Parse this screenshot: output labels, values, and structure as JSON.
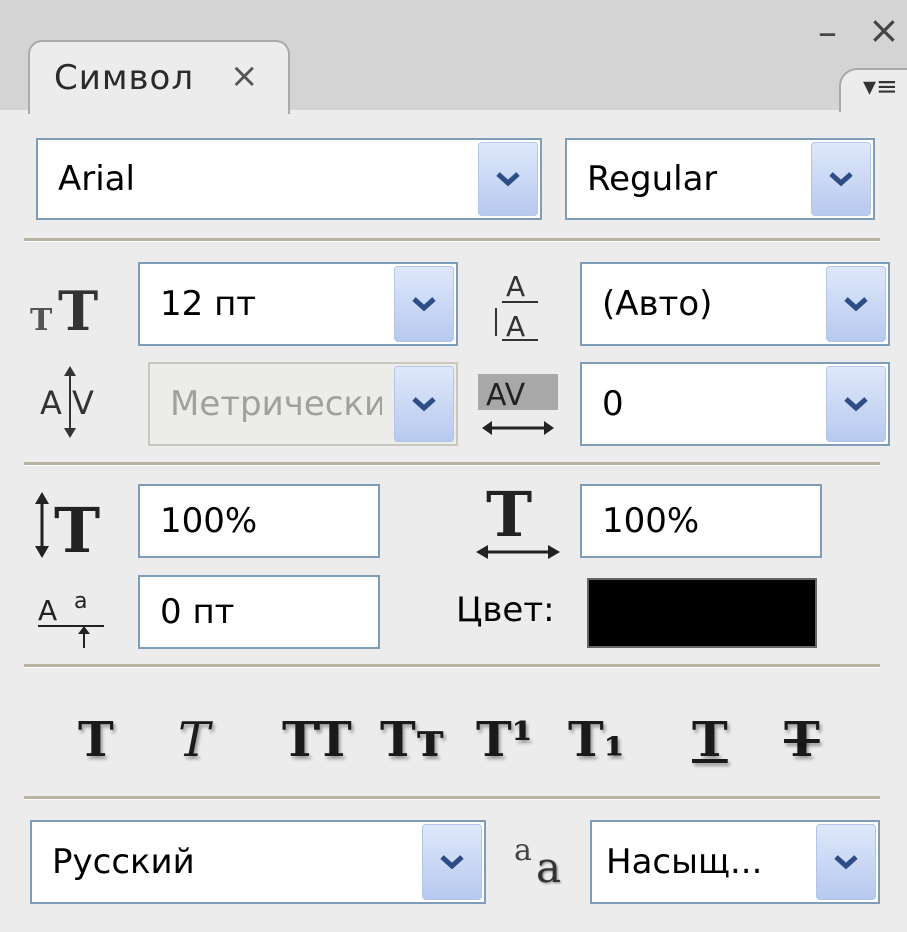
{
  "panel": {
    "tab_label": "Символ",
    "tab_close": "×",
    "minimize": "–",
    "close": "×",
    "flyout_menu": "▾≡"
  },
  "font": {
    "family": "Arial",
    "style": "Regular"
  },
  "metrics": {
    "size": "12 пт",
    "leading": "(Авто)",
    "kerning": "Метрически",
    "tracking": "0"
  },
  "scale": {
    "vertical": "100%",
    "horizontal": "100%",
    "baseline_shift": "0 пт",
    "color_label": "Цвет:",
    "color_value": "#000000"
  },
  "style_buttons": [
    {
      "label": "T",
      "name": "faux-bold"
    },
    {
      "label": "T",
      "name": "faux-italic"
    },
    {
      "label": "TT",
      "name": "all-caps"
    },
    {
      "label": "Tт",
      "name": "small-caps"
    },
    {
      "label": "T¹",
      "name": "superscript"
    },
    {
      "label": "T₁",
      "name": "subscript"
    },
    {
      "label": "T",
      "name": "underline"
    },
    {
      "label": "T",
      "name": "strikethrough"
    }
  ],
  "language": {
    "value": "Русский",
    "antialias_icon_label": "aa",
    "antialias": "Насыщ..."
  }
}
